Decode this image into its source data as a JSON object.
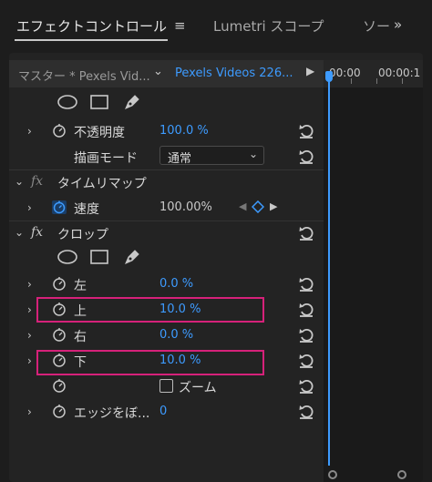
{
  "tabs": {
    "effect_controls": "エフェクトコントロール",
    "menu_glyph": "≡",
    "lumetri_scope": "Lumetri スコープ",
    "truncated": "ソー",
    "overflow": "»"
  },
  "source_bar": {
    "master_label": "マスター * Pexels Vid...",
    "clip_label": "Pexels Videos 226..."
  },
  "timeline": {
    "timecode_start": "00:00",
    "timecode_next": "00:00:1"
  },
  "rows": {
    "opacity_label": "不透明度",
    "opacity_value": "100.0 %",
    "blend_mode_label": "描画モード",
    "blend_mode_value": "通常",
    "time_remap_label": "タイムリマップ",
    "speed_label": "速度",
    "speed_value": "100.00%",
    "crop_label": "クロップ",
    "left_label": "左",
    "left_value": "0.0 %",
    "top_label": "上",
    "top_value": "10.0 %",
    "right_label": "右",
    "right_value": "0.0 %",
    "bottom_label": "下",
    "bottom_value": "10.0 %",
    "zoom_label": "ズーム",
    "edge_label": "エッジをぼ...",
    "edge_value": "0"
  },
  "fx_glyph": "fx",
  "icons": {
    "twirl_closed": "›",
    "twirl_open": "⌄",
    "dropdown_chevron": "⌄",
    "play": "▶",
    "kf_prev": "◀",
    "kf_next": "▶"
  },
  "colors": {
    "accent_blue": "#3d9bff",
    "highlight_magenta": "#d6217a",
    "panel_bg": "#232323"
  }
}
